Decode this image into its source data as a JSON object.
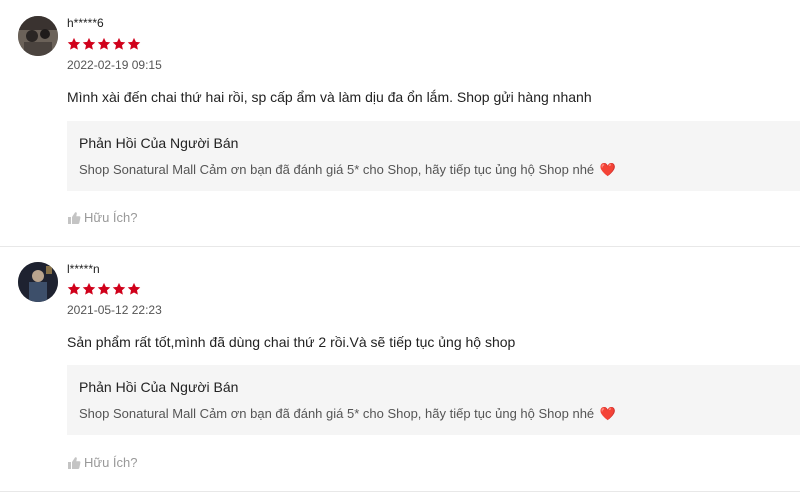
{
  "reviews": [
    {
      "username": "h*****6",
      "rating": 5,
      "date": "2022-02-19 09:15",
      "comment": "Mình xài đến chai thứ hai rồi, sp cấp ẩm và làm dịu đa ổn lắm. Shop gửi hàng nhanh",
      "reply_title": "Phản Hồi Của Người Bán",
      "reply_text": "Shop Sonatural Mall Cảm ơn bạn đã đánh giá 5* cho Shop, hãy tiếp tục ủng hộ Shop nhé",
      "reply_emoji": "❤️",
      "helpful_label": "Hữu Ích?"
    },
    {
      "username": "l*****n",
      "rating": 5,
      "date": "2021-05-12 22:23",
      "comment": "Sản phẩm rất tốt,mình đã dùng chai thứ 2 rồi.Và sẽ tiếp tục ủng hộ shop",
      "reply_title": "Phản Hồi Của Người Bán",
      "reply_text": "Shop Sonatural Mall Cảm ơn bạn đã đánh giá 5* cho Shop, hãy tiếp tục ủng hộ Shop nhé",
      "reply_emoji": "❤️",
      "helpful_label": "Hữu Ích?"
    }
  ],
  "colors": {
    "star": "#d0011b",
    "reply_bg": "#f5f5f5",
    "muted": "#999999"
  },
  "icons": {
    "rating": "star-icon",
    "helpful": "thumbs-up-icon",
    "reply": "heart-emoji"
  }
}
